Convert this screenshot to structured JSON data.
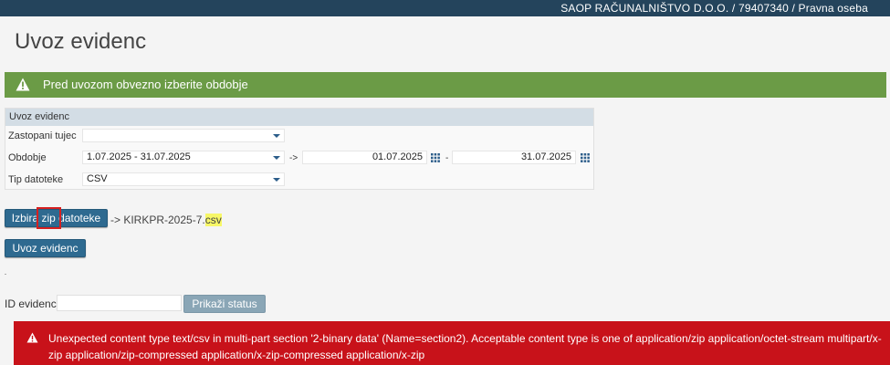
{
  "topbar": {
    "company": "SAOP RAČUNALNIŠTVO D.O.O. / 79407340 / Pravna oseba"
  },
  "page": {
    "title": "Uvoz evidenc"
  },
  "notice": {
    "text": "Pred uvozom obvezno izberite obdobje"
  },
  "form": {
    "header": "Uvoz evidenc",
    "represented_label": "Zastopani tujec",
    "represented_value": "",
    "period_label": "Obdobje",
    "period_value": "1.07.2025 - 31.07.2025",
    "arrow": "->",
    "date_from": "01.07.2025",
    "dash": "-",
    "date_to": "31.07.2025",
    "filetype_label": "Tip datoteke",
    "filetype_value": "CSV"
  },
  "actions": {
    "choose_zip_label": "Izbira zip datoteke",
    "file_prefix": "-> KIRKPR-2025-7.",
    "file_ext": "csv",
    "import_label": "Uvoz evidenc"
  },
  "status": {
    "id_label": "ID evidenc",
    "id_value": "",
    "show_status_label": "Prikaži status"
  },
  "error": {
    "message": "Unexpected content type text/csv in multi-part section '2-binary data' (Name=section2). Acceptable content type is one of application/zip application/octet-stream multipart/x-zip application/zip-compressed application/x-zip-compressed application/x-zip"
  },
  "colors": {
    "topbar": "#24445c",
    "notice": "#6b9b46",
    "button": "#2e6a90",
    "error": "#c8121a",
    "highlight": "#f7f767"
  }
}
